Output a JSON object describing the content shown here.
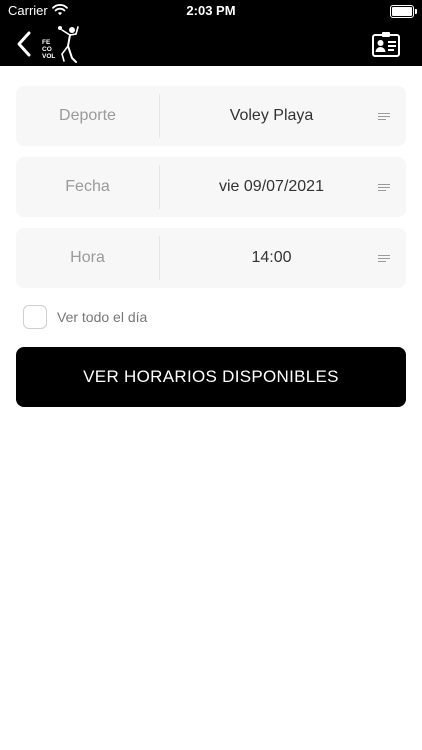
{
  "status_bar": {
    "carrier": "Carrier",
    "time": "2:03 PM"
  },
  "nav": {
    "logo_text": [
      "FE",
      "CO",
      "VOL"
    ],
    "icons": {
      "back": "chevron-left-icon",
      "contact": "contact-card-icon"
    }
  },
  "form": {
    "rows": [
      {
        "label": "Deporte",
        "value": "Voley Playa"
      },
      {
        "label": "Fecha",
        "value": "vie 09/07/2021"
      },
      {
        "label": "Hora",
        "value": "14:00"
      }
    ],
    "checkbox": {
      "label": "Ver todo el día",
      "checked": false
    }
  },
  "cta": {
    "label": "VER HORARIOS DISPONIBLES"
  },
  "colors": {
    "header": "#000000",
    "row_bg": "#f7f7f7",
    "label": "#9a9a9a",
    "value": "#333333"
  }
}
